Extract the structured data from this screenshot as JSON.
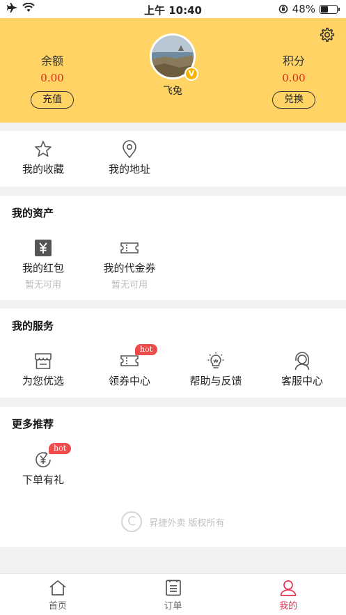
{
  "status_bar": {
    "time": "上午 10:40",
    "battery": "48%",
    "battery_level": 0.48
  },
  "header": {
    "balance_label": "余额",
    "balance_value": "0.00",
    "recharge_label": "充值",
    "points_label": "积分",
    "points_value": "0.00",
    "exchange_label": "兑换",
    "nickname": "飞兔",
    "vip_badge": "V",
    "bg_color": "#ffd465"
  },
  "quick_links": [
    {
      "label": "我的收藏",
      "icon": "star-icon"
    },
    {
      "label": "我的地址",
      "icon": "location-pin-icon"
    }
  ],
  "assets": {
    "title": "我的资产",
    "items": [
      {
        "label": "我的红包",
        "sub": "暂无可用",
        "icon": "yuan-envelope-icon"
      },
      {
        "label": "我的代金券",
        "sub": "暂无可用",
        "icon": "ticket-icon"
      }
    ]
  },
  "services": {
    "title": "我的服务",
    "items": [
      {
        "label": "为您优选",
        "icon": "store-icon"
      },
      {
        "label": "领券中心",
        "icon": "coupon-icon",
        "badge": "hot"
      },
      {
        "label": "帮助与反馈",
        "icon": "lightbulb-icon"
      },
      {
        "label": "客服中心",
        "icon": "headset-icon"
      }
    ]
  },
  "more": {
    "title": "更多推荐",
    "items": [
      {
        "label": "下单有礼",
        "icon": "yuan-refresh-icon",
        "badge": "hot"
      }
    ]
  },
  "copyright": {
    "symbol": "C",
    "text": "昇捷外卖 版权所有"
  },
  "tabbar": [
    {
      "label": "首页",
      "icon": "home-icon",
      "active": false
    },
    {
      "label": "订单",
      "icon": "order-list-icon",
      "active": false
    },
    {
      "label": "我的",
      "icon": "user-icon",
      "active": true
    }
  ],
  "colors": {
    "accent": "#ec2f55",
    "value_red": "#e0271e",
    "hot_badge": "#f04b4b"
  }
}
